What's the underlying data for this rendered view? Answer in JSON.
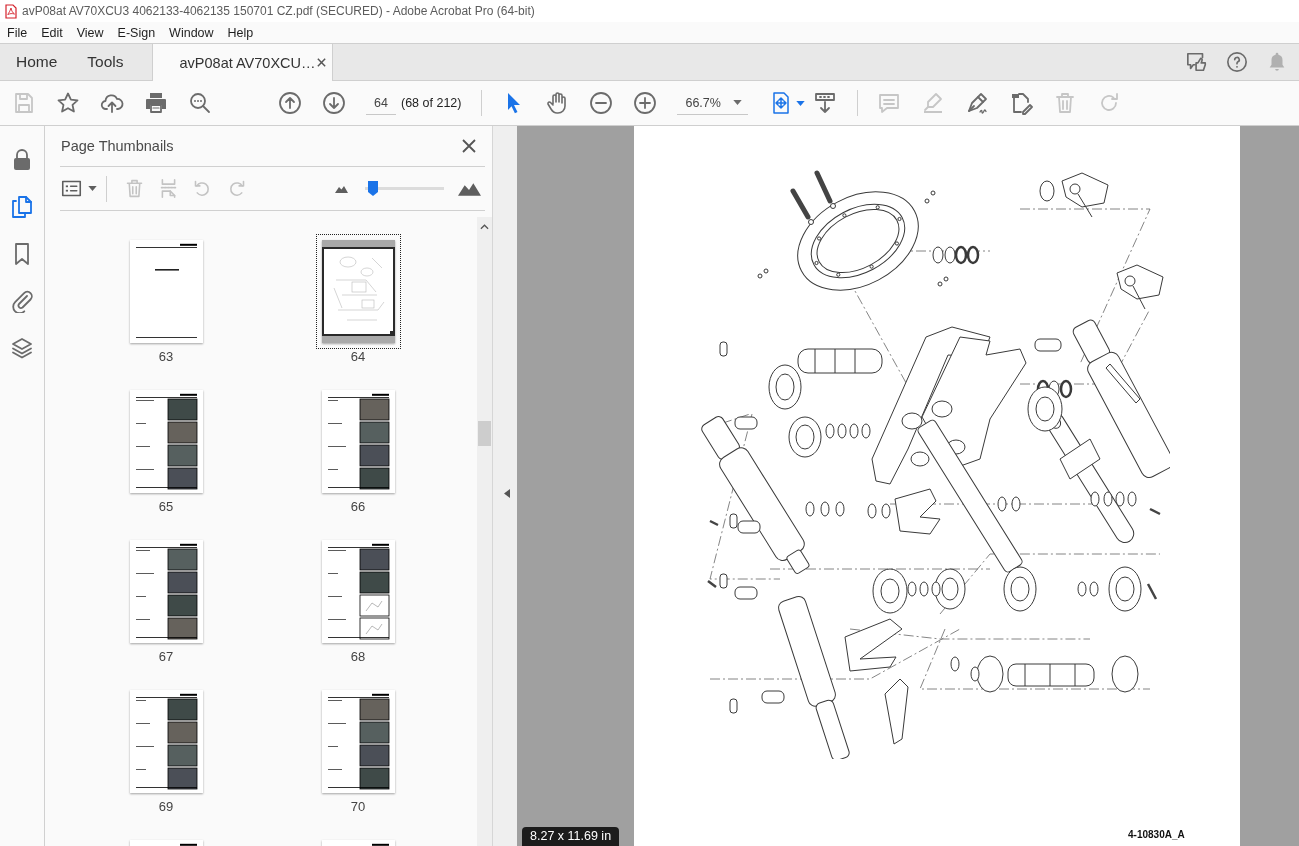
{
  "window": {
    "title": "avP08at AV70XCU3 4062133-4062135 150701 CZ.pdf (SECURED) - Adobe Acrobat Pro (64-bit)"
  },
  "menu": [
    "File",
    "Edit",
    "View",
    "E-Sign",
    "Window",
    "Help"
  ],
  "tabs": [
    {
      "label": "Home",
      "kind": "nav",
      "selected": false
    },
    {
      "label": "Tools",
      "kind": "nav",
      "selected": false
    },
    {
      "label": "avP08at AV70XCU…",
      "kind": "document",
      "selected": true
    }
  ],
  "toolbar": {
    "file_tools": [
      {
        "disabled": true
      },
      {
        "disabled": false
      },
      {
        "disabled": false
      },
      {
        "disabled": false
      },
      {
        "disabled": false
      }
    ],
    "page_number": "64",
    "page_count": "(68 of 212)",
    "pointer_tools": [
      {
        "selected": true
      },
      {
        "selected": false
      }
    ],
    "zoom": "66.7%",
    "annotate_tools": [
      {
        "disabled": true
      },
      {
        "disabled": true
      },
      {
        "disabled": false
      },
      {
        "disabled": false
      },
      {
        "disabled": true
      },
      {
        "disabled": true
      }
    ]
  },
  "rail": [
    {
      "selected": false
    },
    {
      "selected": true
    },
    {
      "selected": false
    },
    {
      "selected": false
    },
    {
      "selected": false
    }
  ],
  "panel": {
    "title": "Page Thumbnails",
    "tools": [
      {
        "disabled": false
      },
      {
        "disabled": true
      },
      {
        "disabled": true
      },
      {
        "disabled": true
      },
      {
        "disabled": true
      }
    ],
    "thumbnail_size": {
      "level": 0.1
    },
    "thumbnails": [
      {
        "label": "63",
        "kind": "title",
        "selected": false
      },
      {
        "label": "64",
        "kind": "diagram",
        "selected": true
      },
      {
        "label": "65",
        "kind": "photos",
        "selected": false
      },
      {
        "label": "66",
        "kind": "photos",
        "selected": false
      },
      {
        "label": "67",
        "kind": "photos",
        "selected": false
      },
      {
        "label": "68",
        "kind": "photos-diagrams",
        "selected": false
      },
      {
        "label": "69",
        "kind": "photos",
        "selected": false
      },
      {
        "label": "70",
        "kind": "photos",
        "selected": false
      },
      {
        "kind": "photos",
        "selected": false
      },
      {
        "kind": "photos",
        "selected": false
      }
    ]
  },
  "document": {
    "caption": "4-10830A_A",
    "page_size": "8.27 x 11.69 in"
  }
}
